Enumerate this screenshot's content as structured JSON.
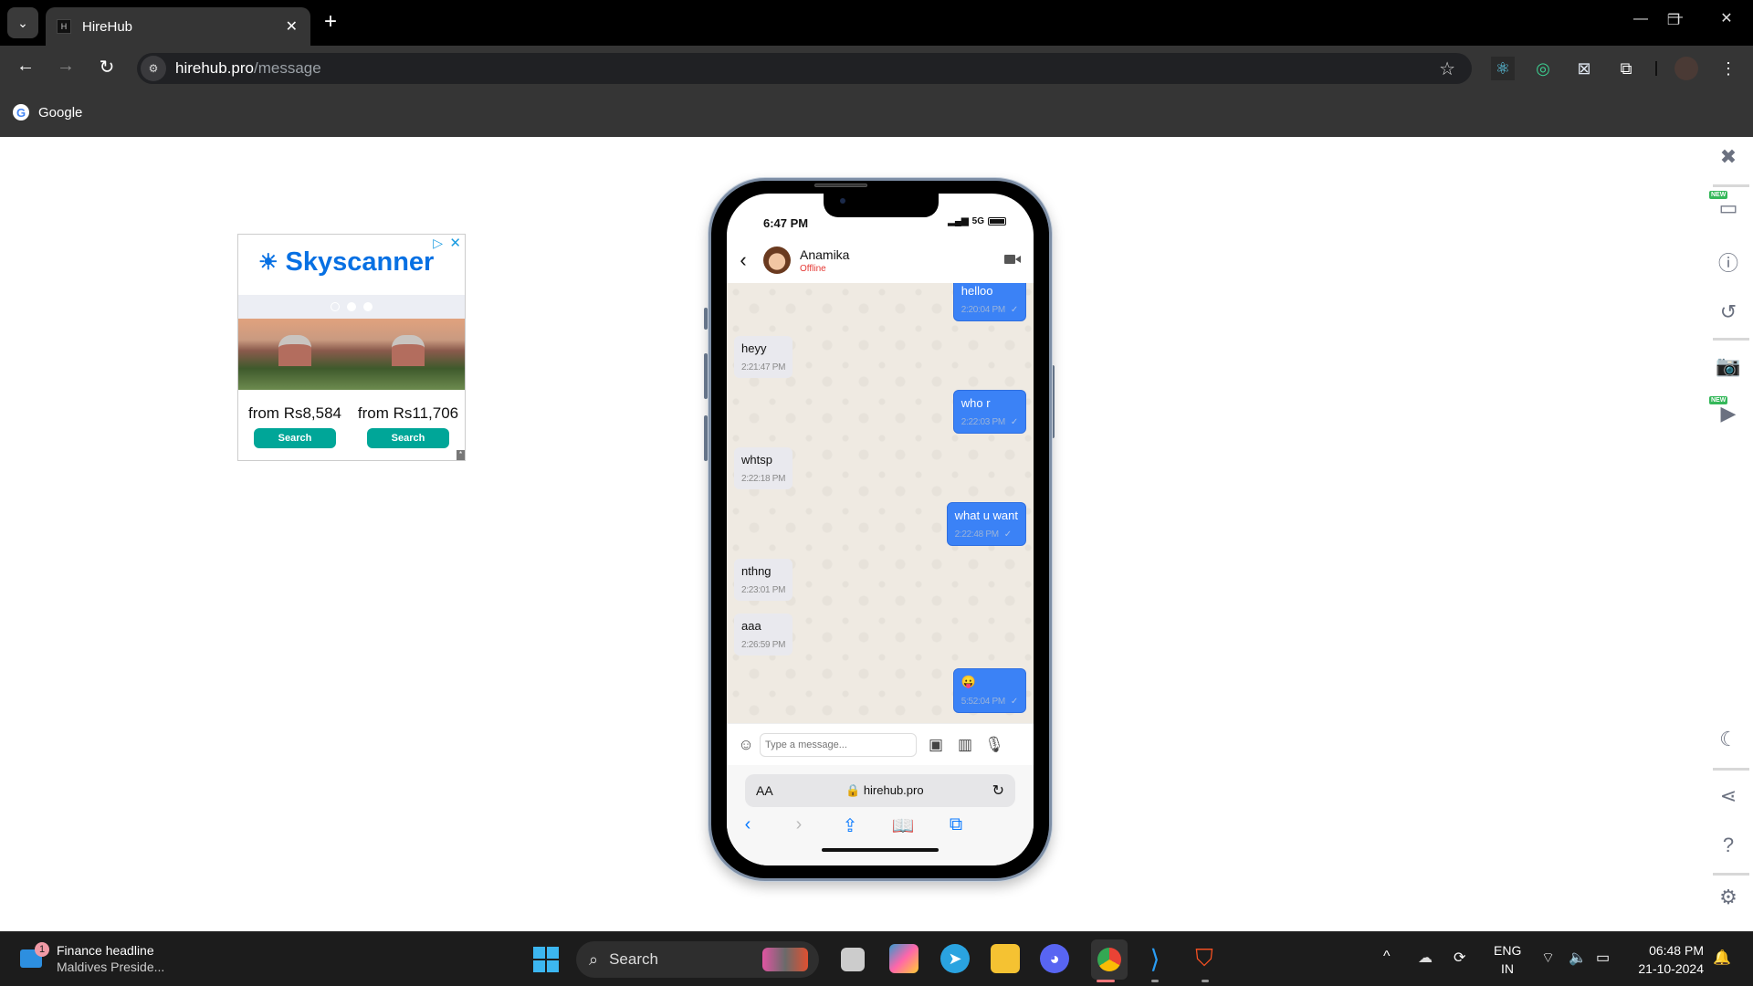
{
  "browser": {
    "tab_title": "HireHub",
    "tab_favicon": "H",
    "url_host": "hirehub.pro",
    "url_path": "/message",
    "bookmarks": [
      {
        "label": "Google",
        "icon": "google-icon"
      }
    ],
    "extensions": [
      "react-devtools-icon",
      "orbit-extension-icon",
      "extension-x-icon",
      "extensions-puzzle-icon"
    ],
    "icons": {
      "back": "←",
      "forward": "→",
      "reload": "↻",
      "star": "☆",
      "menu": "⋮",
      "minimize": "—",
      "restore": "❐",
      "close": "✕",
      "new_tab": "+",
      "tab_list": "⌄"
    }
  },
  "ad": {
    "brand": "Skyscanner",
    "offers": [
      {
        "price": "from Rs8,584",
        "button": "Search"
      },
      {
        "price": "from Rs11,706",
        "button": "Search"
      }
    ]
  },
  "phone": {
    "status_time": "6:47 PM",
    "network": "5G",
    "contact": {
      "name": "Anamika",
      "status": "Offline",
      "status_color": "#e53935"
    },
    "messages": [
      {
        "dir": "out",
        "text": "helloo",
        "time": "2:20:04 PM"
      },
      {
        "dir": "in",
        "text": "heyy",
        "time": "2:21:47 PM"
      },
      {
        "dir": "out",
        "text": "who r",
        "time": "2:22:03 PM"
      },
      {
        "dir": "in",
        "text": "whtsp",
        "time": "2:22:18 PM"
      },
      {
        "dir": "out",
        "text": "what u want",
        "time": "2:22:48 PM"
      },
      {
        "dir": "in",
        "text": "nthng",
        "time": "2:23:01 PM"
      },
      {
        "dir": "in",
        "text": "aaa",
        "time": "2:26:59 PM"
      },
      {
        "dir": "out",
        "text": "😛",
        "time": "5:52:04 PM"
      }
    ],
    "composer_placeholder": "Type a message...",
    "accent": "#3b82f6",
    "safari": {
      "aa": "AA",
      "host": "hirehub.pro"
    }
  },
  "right_panel": {
    "items": [
      "close-icon",
      "responsive-devices-icon",
      "info-icon",
      "rotate-icon",
      "camera-icon",
      "video-record-icon",
      "dark-mode-icon",
      "share-icon",
      "help-icon",
      "settings-icon"
    ],
    "new_badge": "NEW"
  },
  "taskbar": {
    "news_title": "Finance headline",
    "news_sub": "Maldives Preside...",
    "news_badge": "1",
    "search_label": "Search",
    "lang_1": "ENG",
    "lang_2": "IN",
    "time": "06:48 PM",
    "date": "21-10-2024"
  }
}
